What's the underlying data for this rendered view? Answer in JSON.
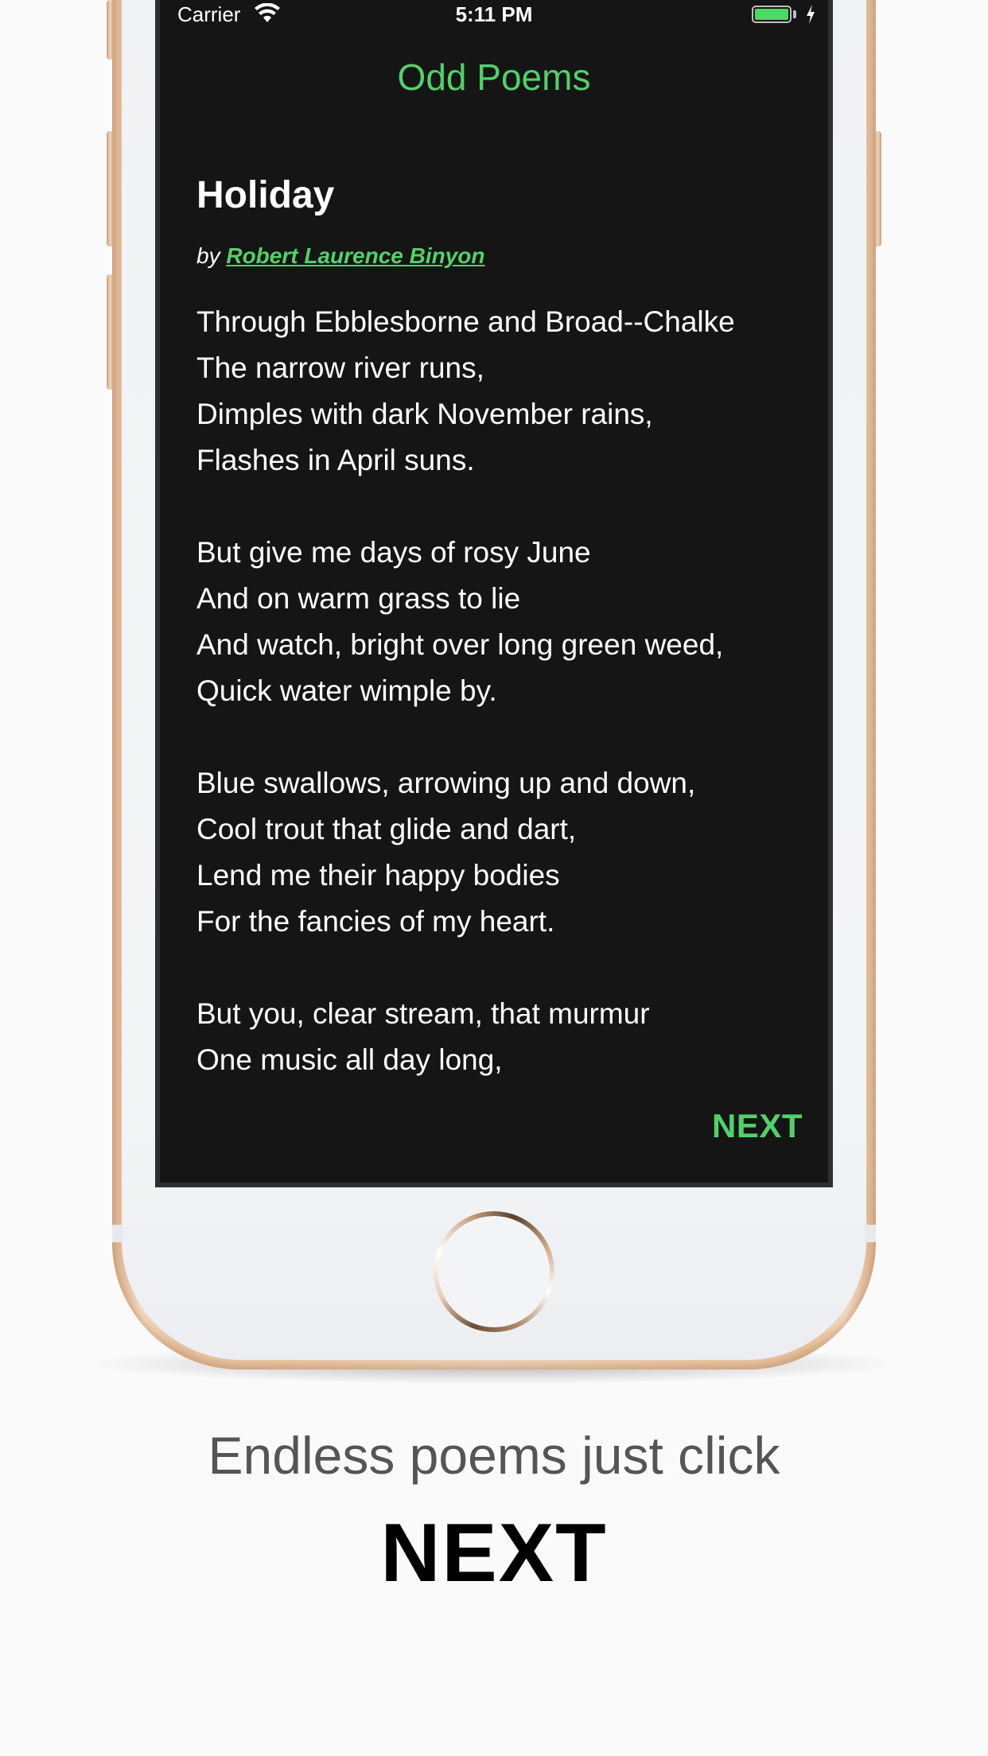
{
  "status_bar": {
    "carrier": "Carrier",
    "time": "5:11 PM",
    "wifi_icon": "wifi-icon",
    "battery_icon": "battery-icon",
    "charging_icon": "charging-bolt-icon"
  },
  "app": {
    "title": "Odd Poems",
    "accent_color": "#52d16a",
    "background_color": "#151515"
  },
  "poem": {
    "title": "Holiday",
    "by_prefix": "by",
    "author": "Robert Laurence Binyon",
    "stanzas": [
      [
        "Through Ebblesborne and Broad--Chalke",
        "The narrow river runs,",
        "Dimples with dark November rains,",
        "Flashes in April suns."
      ],
      [
        "But give me days of rosy June",
        "And on warm grass to lie",
        "And watch, bright over long green weed,",
        "Quick water wimple by."
      ],
      [
        "Blue swallows, arrowing up and down,",
        "Cool trout that glide and dart,",
        "Lend me their happy bodies",
        "For the fancies of my heart."
      ],
      [
        "But you, clear stream, that murmur",
        "One music all day long,"
      ]
    ]
  },
  "next_label": "NEXT",
  "caption": {
    "line1": "Endless poems just click",
    "line2": "NEXT"
  },
  "home_button_icon": "home-button-icon"
}
